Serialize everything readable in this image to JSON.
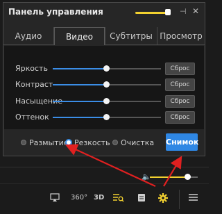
{
  "panel": {
    "title": "Панель управления",
    "tabs": [
      "Аудио",
      "Видео",
      "Субтитры",
      "Просмотр"
    ],
    "active_tab": "Видео",
    "opacity_level": 0.95
  },
  "adjustments": [
    {
      "label": "Яркость",
      "value": 0.5,
      "reset": "Сброс"
    },
    {
      "label": "Контраст",
      "value": 0.5,
      "reset": "Сброс"
    },
    {
      "label": "Насыщение",
      "value": 0.5,
      "reset": "Сброс"
    },
    {
      "label": "Оттенок",
      "value": 0.5,
      "reset": "Сброс"
    }
  ],
  "modes": {
    "options": [
      "Размытие",
      "Резкость",
      "Очистка"
    ],
    "selected": "Резкость"
  },
  "snapshot_label": "Снимок",
  "volume_level": 0.85,
  "bottom_bar": {
    "icons": [
      "airplay-icon",
      "360-icon",
      "3d-icon",
      "playlist-search-icon",
      "subtitle-icon",
      "settings-gear-icon",
      "menu-icon"
    ],
    "label_360": "360°",
    "label_3d": "3D"
  },
  "colors": {
    "accent": "#3b8de6",
    "highlight": "#f2d130",
    "arrow": "#e02020"
  }
}
